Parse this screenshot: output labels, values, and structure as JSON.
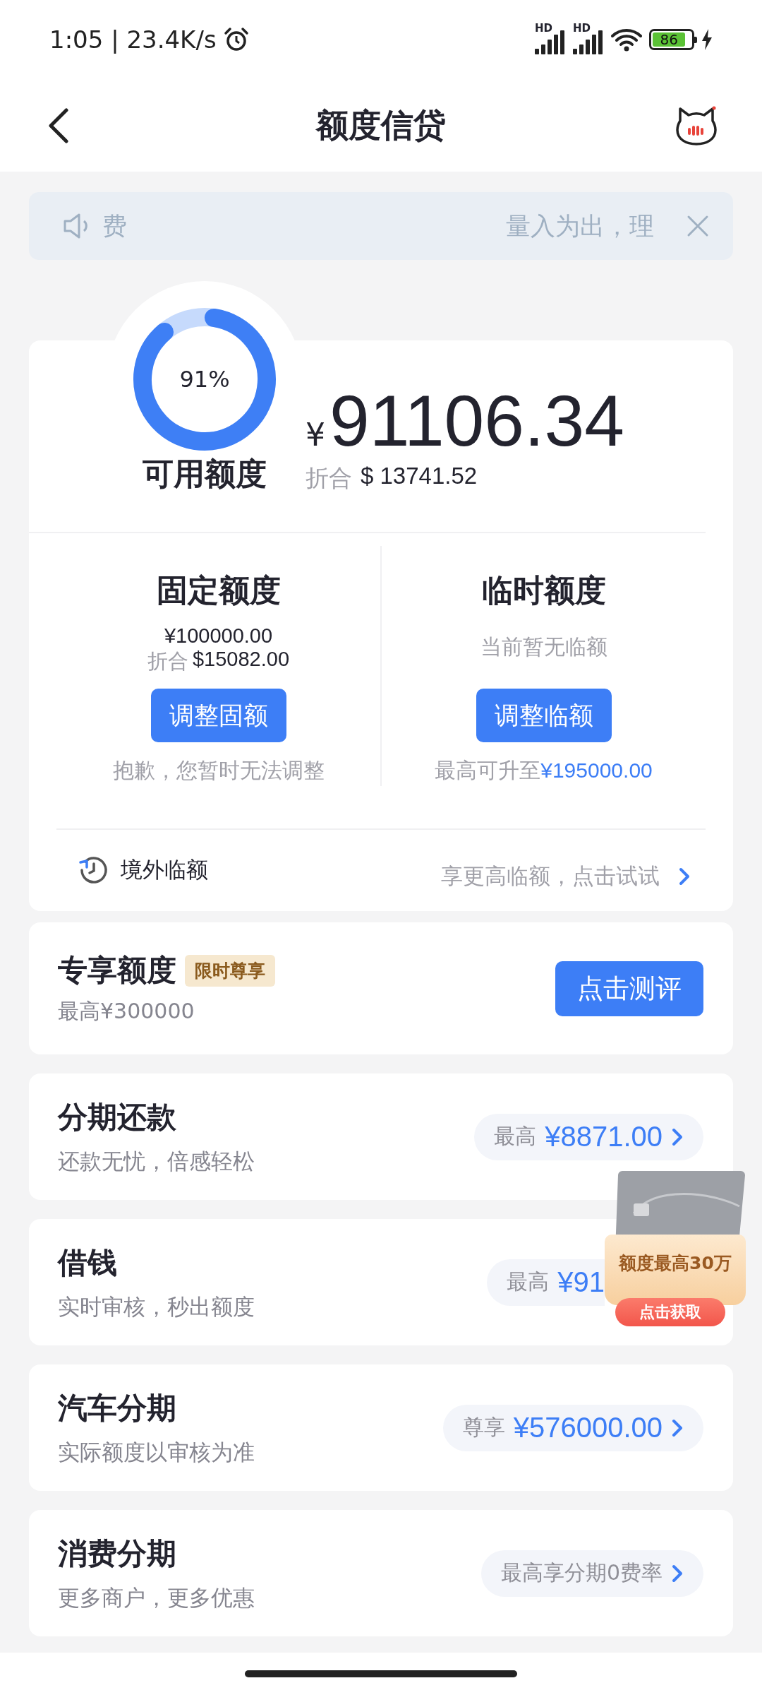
{
  "status_bar": {
    "time": "1:05 | 23.4K/s",
    "signals": [
      {
        "label": "HD"
      },
      {
        "label": "HD"
      }
    ],
    "battery": "86"
  },
  "header": {
    "title": "额度信贷"
  },
  "notice": {
    "text_left": "费",
    "text_right": "量入为出，理"
  },
  "credit": {
    "percent": "91%",
    "label": "可用额度",
    "currency": "¥",
    "amount": "91106.34",
    "converted_label": "折合",
    "converted_amount": "$ 13741.52",
    "sections": [
      {
        "title": "固定额度",
        "amount": "¥100000.00",
        "converted_label": "折合",
        "converted_amount": "$15082.00",
        "button": "调整固额",
        "note": "抱歉，您暂时无法调整"
      },
      {
        "title": "临时额度",
        "info": "当前暂无临额",
        "button": "调整临额",
        "note": "最高可升至",
        "note_amount": "¥195000.00"
      }
    ],
    "overseas": {
      "label": "境外临额",
      "action": "享更高临额，点击试试"
    }
  },
  "exclusive": {
    "title": "专享额度",
    "tag": "限时尊享",
    "subtitle": "最高¥300000",
    "button": "点击测评"
  },
  "products": [
    {
      "title": "分期还款",
      "subtitle": "还款无忧，倍感轻松",
      "chip_label": "最高",
      "chip_value": "¥8871.00",
      "arrow": true
    },
    {
      "title": "借钱",
      "subtitle": "实时审核，秒出额度",
      "chip_label": "最高",
      "chip_value": "¥91",
      "arrow": false
    },
    {
      "title": "汽车分期",
      "subtitle": "实际额度以审核为准",
      "chip_label": "尊享",
      "chip_value": "¥576000.00",
      "arrow": true
    },
    {
      "title": "消费分期",
      "subtitle": "更多商户，更多优惠",
      "chip_label": "最高享分期0费率",
      "arrow": true
    }
  ],
  "promo": {
    "text": "额度最高30万",
    "button": "点击获取"
  }
}
